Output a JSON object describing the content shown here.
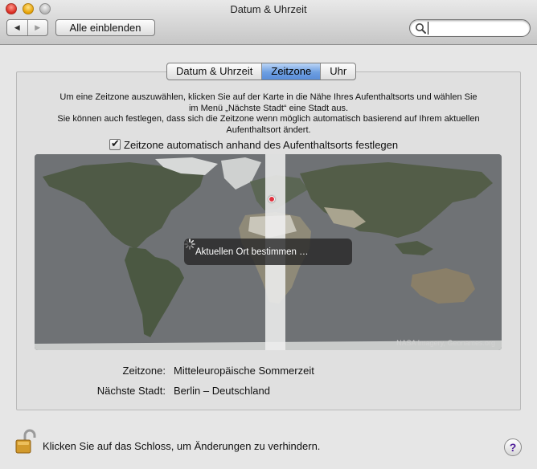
{
  "window": {
    "title": "Datum & Uhrzeit"
  },
  "toolbar": {
    "back": "◀",
    "forward": "▶",
    "show_all": "Alle einblenden"
  },
  "search": {
    "placeholder": "",
    "value": "",
    "icon": "magnifier-icon"
  },
  "tabs": [
    {
      "label": "Datum & Uhrzeit",
      "selected": false
    },
    {
      "label": "Zeitzone",
      "selected": true
    },
    {
      "label": "Uhr",
      "selected": false
    }
  ],
  "timezone": {
    "info_line1": "Um eine Zeitzone auszuwählen, klicken Sie auf der Karte in die Nähe Ihres Aufenthaltsorts und wählen Sie",
    "info_line2": "im Menü „Nächste Stadt“ eine Stadt aus.",
    "info_line3": "Sie können auch festlegen, dass sich die Zeitzone wenn möglich automatisch basierend auf Ihrem aktuellen",
    "info_line4": "Aufenthaltsort ändert.",
    "auto_checkbox_label": "Zeitzone automatisch anhand des Aufenthaltsorts festlegen",
    "auto_checked": true,
    "locating_text": "Aktuellen Ort bestimmen …",
    "map_credit": "NASA Imagery, Geonames.org",
    "zone_label": "Zeitzone:",
    "zone_value": "Mitteleuropäische Sommerzeit",
    "city_label": "Nächste Stadt:",
    "city_value": "Berlin – Deutschland"
  },
  "footer": {
    "lock_text": "Klicken Sie auf das Schloss, um Änderungen zu verhindern.",
    "help": "?"
  },
  "colors": {
    "accent": "#6d9fe1",
    "pin": "#e0313d",
    "help": "#4f1d9a"
  }
}
